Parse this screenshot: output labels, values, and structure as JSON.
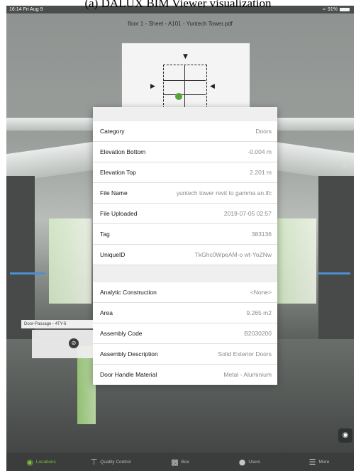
{
  "caption": "(a) DALUX BIM Viewer visualization",
  "statusbar": {
    "time": "16:14  Fri Aug 9",
    "battery": "91%"
  },
  "plan": {
    "title": "floor 1 - Sheet - A101 - Yuntech Tower.pdf"
  },
  "properties": {
    "group1": [
      {
        "key": "Category",
        "value": "Doors"
      },
      {
        "key": "Elevation Bottom",
        "value": "-0.004 m"
      },
      {
        "key": "Elevation Top",
        "value": "2.201 m"
      },
      {
        "key": "File Name",
        "value": "yuntech tower revit to gamma an.ifc"
      },
      {
        "key": "File Uploaded",
        "value": "2019-07-05 02:57"
      },
      {
        "key": "Tag",
        "value": "383136"
      },
      {
        "key": "UniqueID",
        "value": "TkGhc0WpeAM-o wt-YoZNw"
      }
    ],
    "group2": [
      {
        "key": "Analytic Construction",
        "value": "<None>"
      },
      {
        "key": "Area",
        "value": "9.265 m2"
      },
      {
        "key": "Assembly Code",
        "value": "B2030200"
      },
      {
        "key": "Assembly Description",
        "value": "Solid Exterior Doors"
      },
      {
        "key": "Door Handle Material",
        "value": "Metal - Aluminium"
      }
    ]
  },
  "floating_label": "Door-Passage - 4TY-6",
  "tabs": [
    {
      "label": "Locations",
      "icon": "location-pin-icon",
      "active": true
    },
    {
      "label": "Quality Control",
      "icon": "measure-icon",
      "active": false
    },
    {
      "label": "Box",
      "icon": "folder-icon",
      "active": false
    },
    {
      "label": "Users",
      "icon": "users-icon",
      "active": false
    },
    {
      "label": "More",
      "icon": "menu-icon",
      "active": false
    }
  ],
  "colors": {
    "accent_green": "#7fbf3f",
    "tabbar_bg": "#3a3d3b"
  }
}
